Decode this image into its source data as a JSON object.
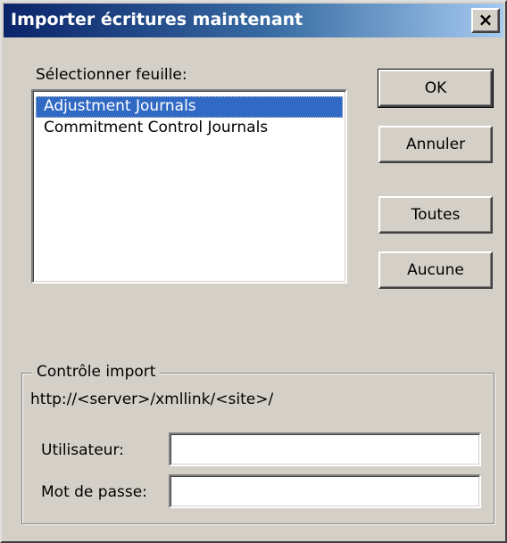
{
  "window": {
    "title": "Importer écritures maintenant",
    "close_label": "×"
  },
  "sheet": {
    "label": "Sélectionner feuille:",
    "items": [
      {
        "label": "Adjustment Journals",
        "selected": true
      },
      {
        "label": "Commitment Control Journals",
        "selected": false
      }
    ]
  },
  "buttons": {
    "ok": "OK",
    "cancel": "Annuler",
    "all": "Toutes",
    "none": "Aucune"
  },
  "import_control": {
    "legend": "Contrôle import",
    "url": "http://<server>/xmllink/<site>/",
    "user_label": "Utilisateur:",
    "user_value": "",
    "password_label": "Mot de passe:",
    "password_value": ""
  },
  "colors": {
    "title_bar_start": "#0a246a",
    "title_bar_end": "#a6caf0",
    "selection": "#316ac5",
    "face": "#d4d0c8"
  }
}
